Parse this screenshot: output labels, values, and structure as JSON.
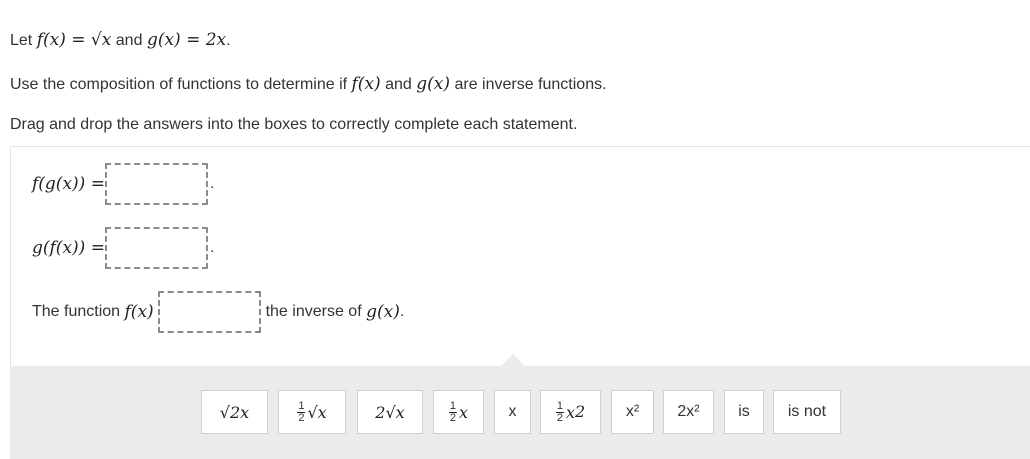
{
  "prompt": {
    "let": "Let",
    "f_def": "f(x) = √x",
    "and": "and",
    "g_def": "g(x) = 2x",
    "period": ".",
    "use_before": "Use the composition of functions to determine if",
    "f_x": "f(x)",
    "use_and": "and",
    "g_x": "g(x)",
    "use_after": "are inverse functions.",
    "instructions": "Drag and drop the answers into the boxes to correctly complete each statement."
  },
  "statements": {
    "fg_label": "f(g(x)) =",
    "gf_label": "g(f(x)) =",
    "fn_before": "The function",
    "fn_f": "f(x)",
    "fn_after": "the inverse of",
    "fn_g": "g(x)",
    "period": "."
  },
  "tiles": {
    "t1": "√2x",
    "t2_frac_num": "1",
    "t2_frac_den": "2",
    "t2_rest": "√x",
    "t3": "2√x",
    "t4_frac_num": "1",
    "t4_frac_den": "2",
    "t4_rest": "x",
    "t5": "x",
    "t6_frac_num": "1",
    "t6_frac_den": "2",
    "t6_rest": "x",
    "t6_sup": "2",
    "t7": "x²",
    "t8": "2x²",
    "t9": "is",
    "t10": "is not"
  }
}
